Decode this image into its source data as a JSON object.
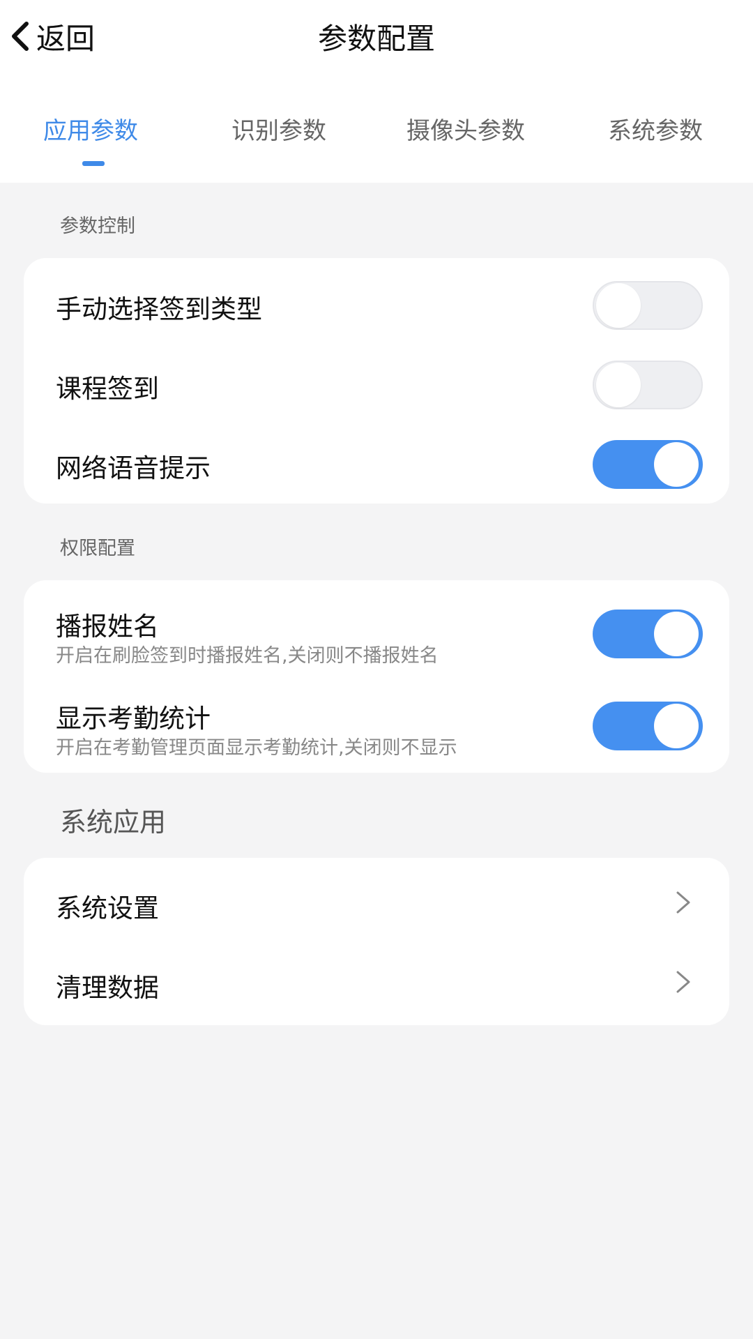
{
  "header": {
    "back_label": "返回",
    "title": "参数配置"
  },
  "tabs": [
    {
      "label": "应用参数",
      "active": true
    },
    {
      "label": "识别参数",
      "active": false
    },
    {
      "label": "摄像头参数",
      "active": false
    },
    {
      "label": "系统参数",
      "active": false
    }
  ],
  "sections": {
    "param_control": {
      "label": "参数控制",
      "items": [
        {
          "title": "手动选择签到类型",
          "enabled": false
        },
        {
          "title": "课程签到",
          "enabled": false
        },
        {
          "title": "网络语音提示",
          "enabled": true
        }
      ]
    },
    "permission": {
      "label": "权限配置",
      "items": [
        {
          "title": "播报姓名",
          "subtitle": "开启在刷脸签到时播报姓名,关闭则不播报姓名",
          "enabled": true
        },
        {
          "title": "显示考勤统计",
          "subtitle": "开启在考勤管理页面显示考勤统计,关闭则不显示",
          "enabled": true
        }
      ]
    },
    "system_apps": {
      "label": "系统应用",
      "items": [
        {
          "title": "系统设置",
          "icon": "chevron-right-icon"
        },
        {
          "title": "清理数据",
          "icon": "chevron-right-icon"
        }
      ]
    }
  },
  "colors": {
    "accent": "#3f8ae8",
    "toggle_on": "#4590f0",
    "toggle_off": "#eeeff2",
    "background": "#f4f4f5"
  }
}
